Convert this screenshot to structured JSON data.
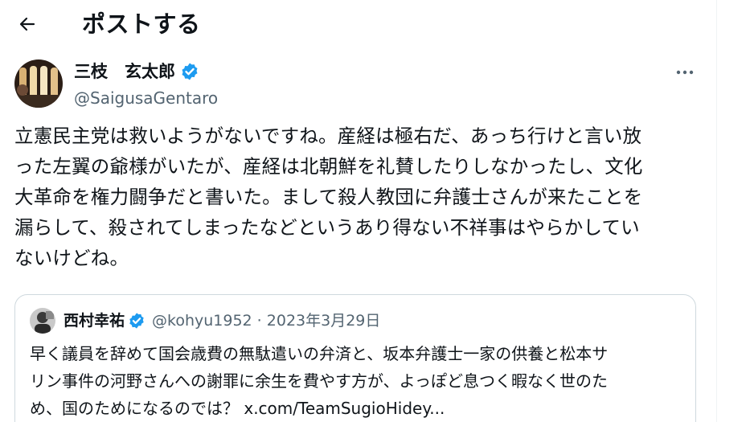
{
  "header": {
    "back_icon": "arrow-left-icon",
    "title": "ポストする"
  },
  "author": {
    "name": "三枝　玄太郎",
    "handle": "@SaigusaGentaro",
    "verified_icon": "verified-badge-icon",
    "verified_color": "#1d9bf0"
  },
  "more_icon": "more-horizontal-icon",
  "tweet": {
    "lines": [
      "立憲民主党は救いようがないですね。産経は極右だ、あっち行けと言い放",
      "った左翼の爺様がいたが、産経は北朝鮮を礼賛したりしなかったし、文化",
      "大革命を権力闘争だと書いた。まして殺人教団に弁護士さんが来たことを",
      "漏らして、殺されてしまったなどというあり得ない不祥事はやらかしてい",
      "ないけどね。"
    ]
  },
  "quote": {
    "name": "西村幸祐",
    "handle_date": "@kohyu1952 · 2023年3月29日",
    "lines": [
      "早く議員を辞めて国会歳費の無駄遣いの弁済と、坂本弁護士一家の供養と松本サ",
      "リン事件の河野さんへの謝罪に余生を費やす方が、よっぽど息つく暇なく世のた",
      "め、国のためになるのでは？  x.com/TeamSugioHidey..."
    ]
  },
  "colors": {
    "text": "#0f1419",
    "secondary": "#536471",
    "border": "#cfd9de",
    "accent": "#1d9bf0"
  }
}
